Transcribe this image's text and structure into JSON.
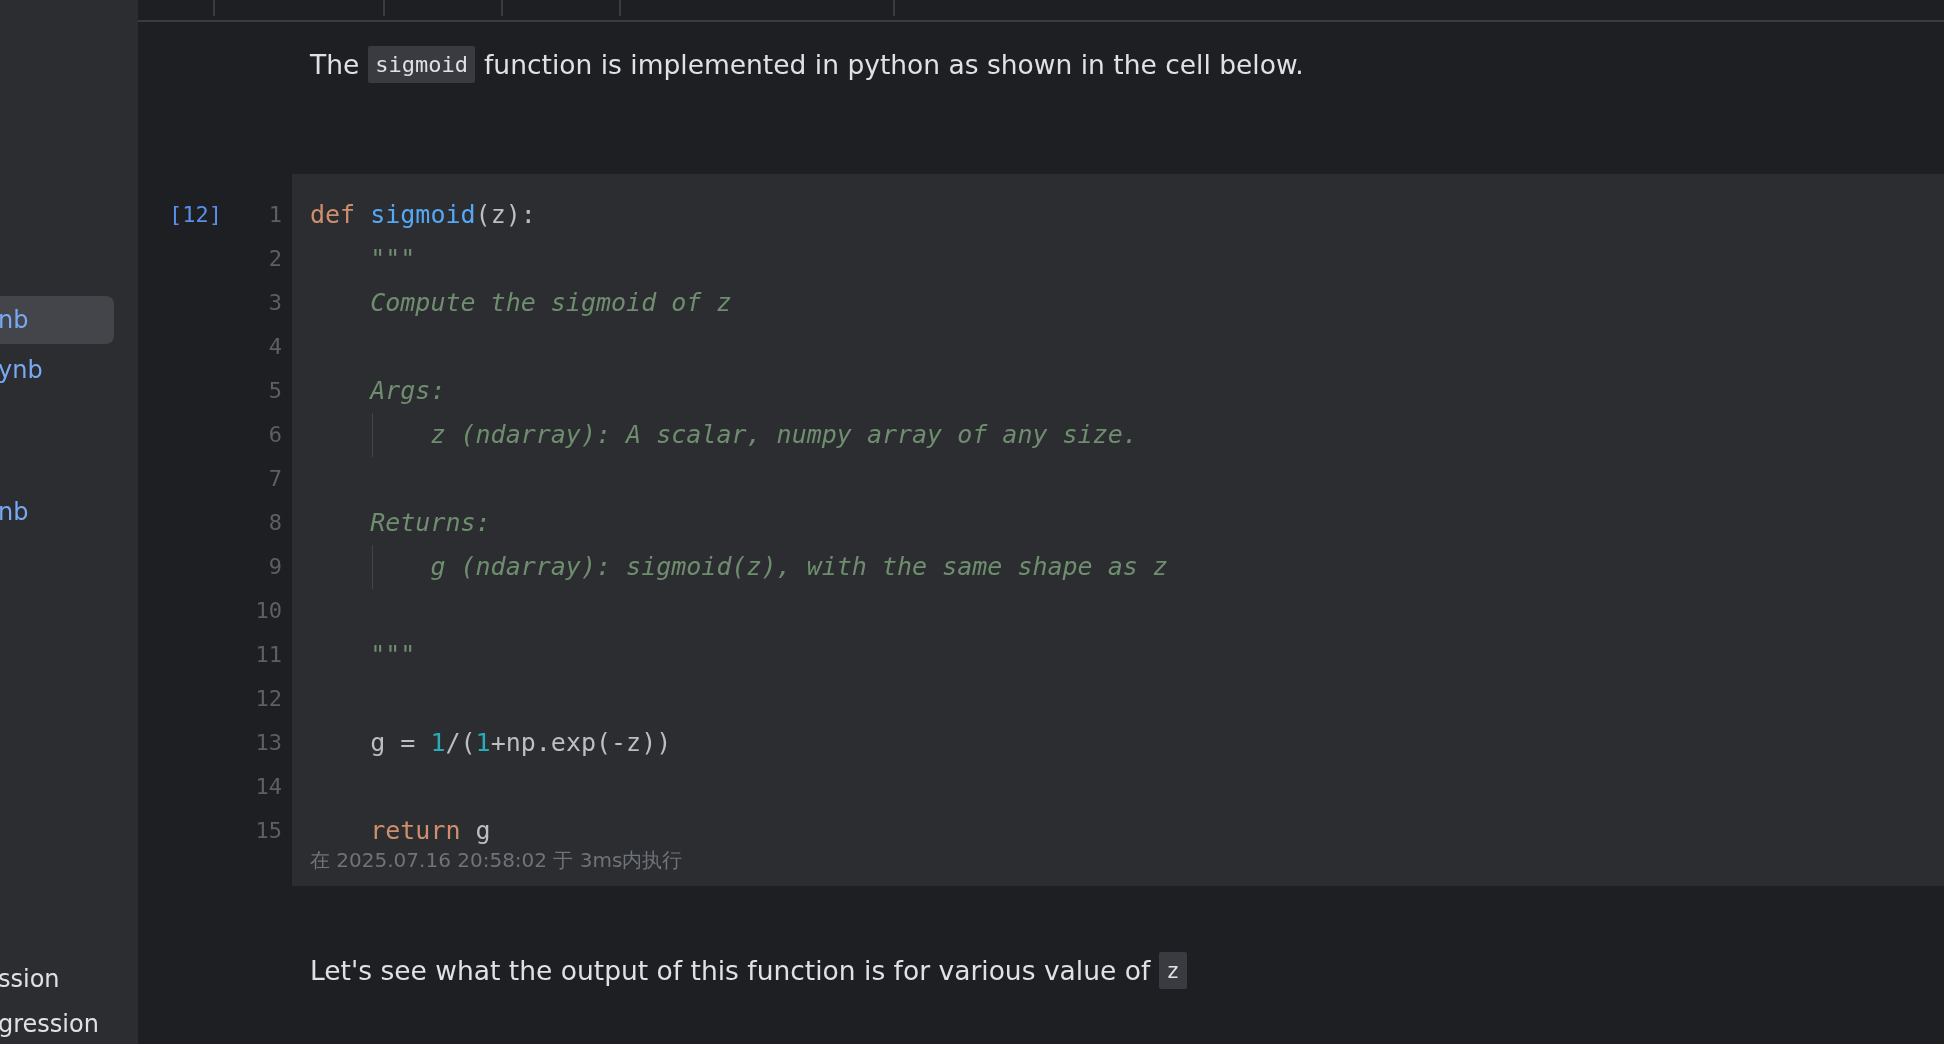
{
  "sidebar": {
    "top_items": [
      {
        "label": "nb",
        "kind": "notebook",
        "selected": true
      },
      {
        "label": "ynb",
        "kind": "notebook",
        "selected": false
      },
      {
        "label": "nb",
        "kind": "notebook",
        "selected": false
      }
    ],
    "bottom_items": [
      {
        "label": "ssion",
        "kind": "folder",
        "selected": false
      },
      {
        "label": "gression",
        "kind": "folder",
        "selected": false
      }
    ]
  },
  "notebook": {
    "cells": [
      {
        "kind": "markdown",
        "parts": [
          {
            "kind": "text",
            "text": "The"
          },
          {
            "kind": "code",
            "text": "sigmoid"
          },
          {
            "kind": "text",
            "text": "function is implemented in python as shown in the cell below."
          }
        ]
      },
      {
        "kind": "code",
        "execution_count": "[12]",
        "lines": [
          {
            "number": "1",
            "tokens": [
              {
                "kind": "keyword",
                "text": "def "
              },
              {
                "kind": "function",
                "text": "sigmoid"
              },
              {
                "kind": "plain",
                "text": "(z):"
              }
            ]
          },
          {
            "number": "2",
            "tokens": [
              {
                "kind": "comment",
                "text": "    \"\"\""
              }
            ]
          },
          {
            "number": "3",
            "tokens": [
              {
                "kind": "comment",
                "text": "    Compute the sigmoid of z"
              }
            ]
          },
          {
            "number": "4"
          },
          {
            "number": "5",
            "tokens": [
              {
                "kind": "comment",
                "text": "    Args:"
              }
            ]
          },
          {
            "number": "6",
            "tokens": [
              {
                "kind": "comment",
                "text": "        z (ndarray): A scalar, numpy array of any size."
              }
            ]
          },
          {
            "number": "7"
          },
          {
            "number": "8",
            "tokens": [
              {
                "kind": "comment",
                "text": "    Returns:"
              }
            ]
          },
          {
            "number": "9",
            "tokens": [
              {
                "kind": "comment",
                "text": "        g (ndarray): sigmoid(z), with the same shape as z"
              }
            ]
          },
          {
            "number": "10"
          },
          {
            "number": "11",
            "tokens": [
              {
                "kind": "comment",
                "text": "    \"\"\""
              }
            ]
          },
          {
            "number": "12"
          },
          {
            "number": "13",
            "tokens": [
              {
                "kind": "plain",
                "text": "    g = "
              },
              {
                "kind": "number",
                "text": "1"
              },
              {
                "kind": "plain",
                "text": "/("
              },
              {
                "kind": "number",
                "text": "1"
              },
              {
                "kind": "plain",
                "text": "+np.exp(-z))"
              }
            ]
          },
          {
            "number": "14"
          },
          {
            "number": "15",
            "tokens": [
              {
                "kind": "keyword",
                "text": "    return "
              },
              {
                "kind": "plain",
                "text": "g"
              }
            ]
          }
        ],
        "execution_info": "在 2025.07.16 20:58:02 于 3ms内执行"
      },
      {
        "kind": "markdown",
        "parts": [
          {
            "kind": "text",
            "text": "Let's see what the output of this function is for various value of"
          },
          {
            "kind": "code",
            "text": "z"
          }
        ]
      }
    ]
  }
}
